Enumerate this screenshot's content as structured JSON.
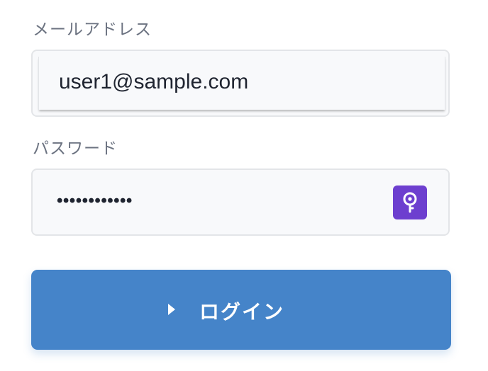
{
  "form": {
    "email": {
      "label": "メールアドレス",
      "value": "user1@sample.com"
    },
    "password": {
      "label": "パスワード",
      "masked_value": "••••••••••••"
    },
    "login_button": {
      "label": "ログイン"
    }
  },
  "icons": {
    "password_toggle": "key-icon",
    "login": "play-icon"
  },
  "colors": {
    "label_text": "#6b7280",
    "field_background": "#f8f9fb",
    "field_border": "#e3e5e8",
    "accent_purple": "#6d3fcf",
    "login_blue": "#4584c9"
  }
}
